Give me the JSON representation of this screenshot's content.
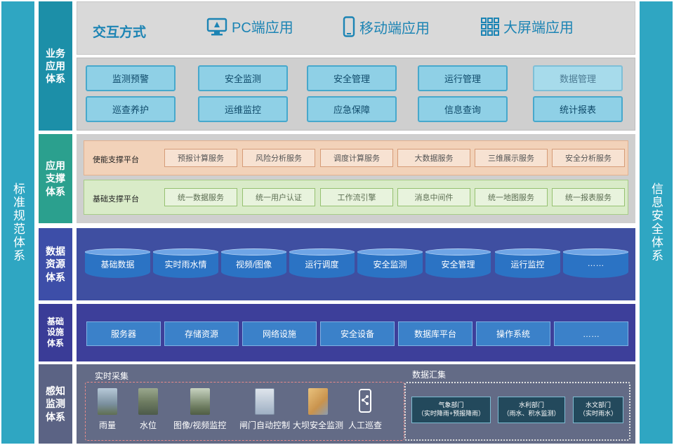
{
  "side_left": "标准规范体系",
  "side_right": "信息安全体系",
  "layers": {
    "business": {
      "label": "业务应用体系",
      "mode_title": "交互方式",
      "modes": [
        {
          "label": "PC端应用",
          "icon": "monitor-icon"
        },
        {
          "label": "移动端应用",
          "icon": "mobile-phone-icon"
        },
        {
          "label": "大屏端应用",
          "icon": "grid-icon"
        }
      ],
      "apps_row1": [
        "监测预警",
        "安全监测",
        "安全管理",
        "运行管理",
        "数据管理"
      ],
      "apps_row2": [
        "巡查养护",
        "运维监控",
        "应急保障",
        "信息查询",
        "统计报表"
      ]
    },
    "support": {
      "label": "应用支撑体系",
      "enabling": {
        "title": "使能支撑平台",
        "services": [
          "预报计算服务",
          "风险分析服务",
          "调度计算服务",
          "大数据服务",
          "三维展示服务",
          "安全分析服务"
        ]
      },
      "basic": {
        "title": "基础支撑平台",
        "services": [
          "统一数据服务",
          "统一用户认证",
          "工作流引擎",
          "消息中间件",
          "统一地图服务",
          "统一报表服务"
        ]
      }
    },
    "data": {
      "label": "数据资源体系",
      "stores": [
        "基础数据",
        "实时雨水情",
        "视频/图像",
        "运行调度",
        "安全监测",
        "安全管理",
        "运行监控",
        "……"
      ]
    },
    "infra": {
      "label": "基础设施体系",
      "items": [
        "服务器",
        "存储资源",
        "网络设施",
        "安全设备",
        "数据库平台",
        "操作系统",
        "……"
      ]
    },
    "sensing": {
      "label": "感知监测体系",
      "realtime_title": "实时采集",
      "collect_title": "数据汇集",
      "sensors": [
        "雨量",
        "水位",
        "图像/视频监控",
        "闸门自动控制",
        "大坝安全监测",
        "人工巡查"
      ],
      "departments": [
        {
          "name": "气象部门",
          "detail": "（实时降雨+预报降雨）"
        },
        {
          "name": "水利部门",
          "detail": "（雨水、积水监测）"
        },
        {
          "name": "水文部门",
          "detail": "（实时雨水）"
        }
      ]
    }
  },
  "colors": {
    "side": "#2fa6c2",
    "business_label": "#1c8fa8",
    "support_label": "#2ba08e",
    "data_label": "#3d4ea8",
    "infra_label": "#3a3c97",
    "sensing_label": "#5b6384"
  }
}
